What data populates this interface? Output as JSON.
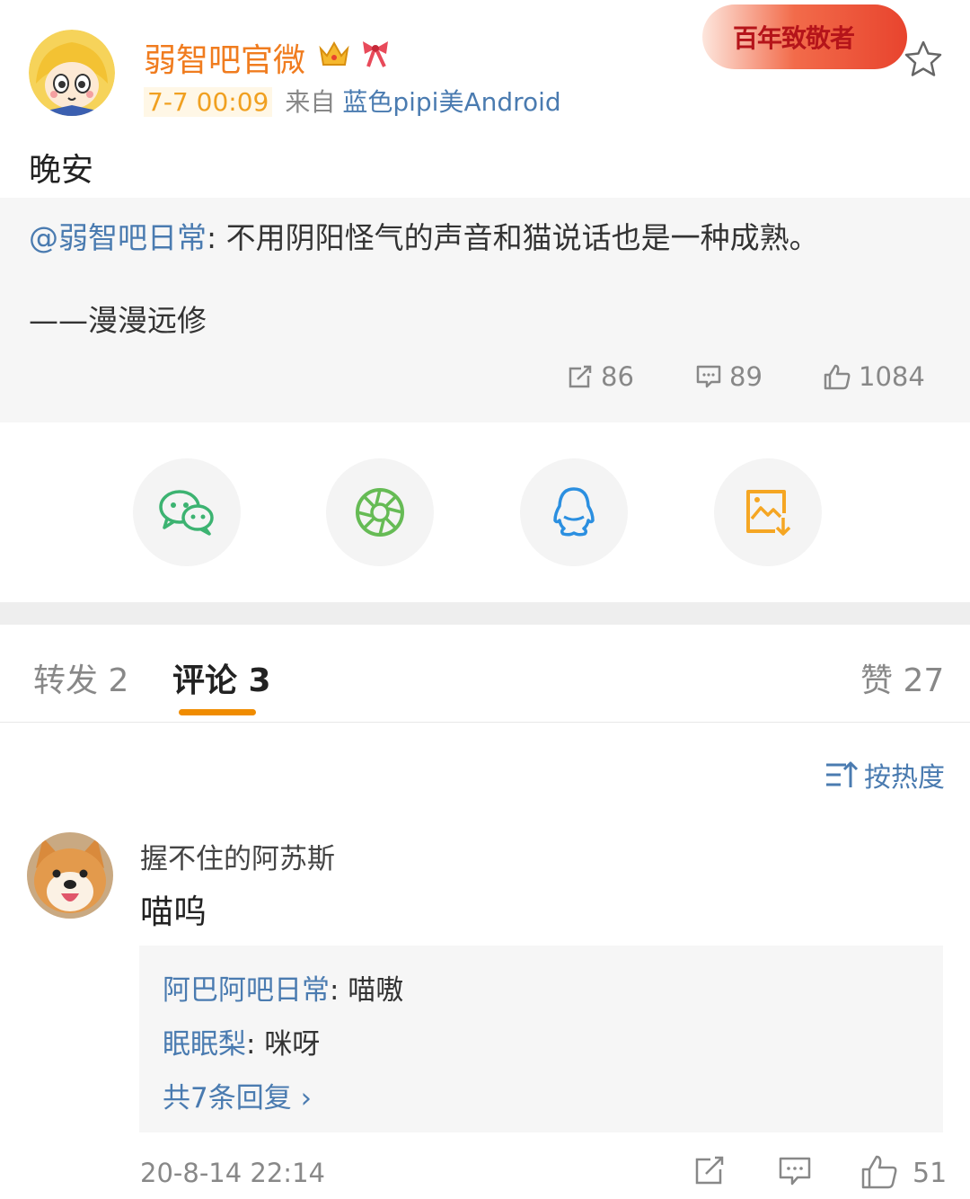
{
  "post": {
    "username": "弱智吧官微",
    "time": "7-7 00:09",
    "from_prefix": "来自",
    "device": "蓝色pipi美Android",
    "banner_text": "百年致敬者",
    "text": "晚安"
  },
  "retweet": {
    "mention": "@弱智吧日常",
    "content": ": 不用阴阳怪气的声音和猫说话也是一种成熟。",
    "signature": "——漫漫远修",
    "reposts": "86",
    "comments": "89",
    "likes": "1084"
  },
  "share": [
    "wechat-icon",
    "moments-icon",
    "qq-icon",
    "save-image-icon"
  ],
  "tabs": {
    "repost": "转发 2",
    "comment": "评论 3",
    "like": "赞 27"
  },
  "sort_label": "按热度",
  "comment": {
    "user": "握不住的阿苏斯",
    "text": "喵呜",
    "replies": [
      {
        "who": "阿巴阿吧日常",
        "text": ": 喵嗷"
      },
      {
        "who": "眠眠梨",
        "text": ": 咪呀"
      }
    ],
    "more_replies": "共7条回复 ›",
    "time": "20-8-14 22:14",
    "like_count": "51"
  },
  "colors": {
    "accent_orange": "#f08c00",
    "link_blue": "#4a7bb0",
    "username_orange": "#f07c1f"
  }
}
